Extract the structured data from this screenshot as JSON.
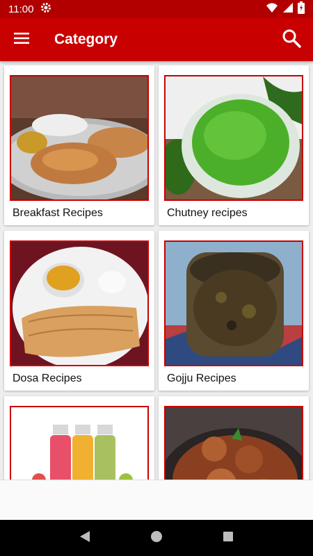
{
  "status_bar": {
    "time": "11:00"
  },
  "app_bar": {
    "title": "Category"
  },
  "categories": [
    {
      "label": "Breakfast Recipes",
      "image": "breakfast-poori-plate"
    },
    {
      "label": "Chutney recipes",
      "image": "green-chutney-bowl"
    },
    {
      "label": "Dosa Recipes",
      "image": "dosa-plate"
    },
    {
      "label": "Gojju Recipes",
      "image": "gojju-jar"
    },
    {
      "label": "",
      "image": "juice-bottles"
    },
    {
      "label": "",
      "image": "chicken-curry"
    }
  ],
  "colors": {
    "primary": "#c90000",
    "status_bar": "#b20000",
    "background": "#eeeeee"
  }
}
